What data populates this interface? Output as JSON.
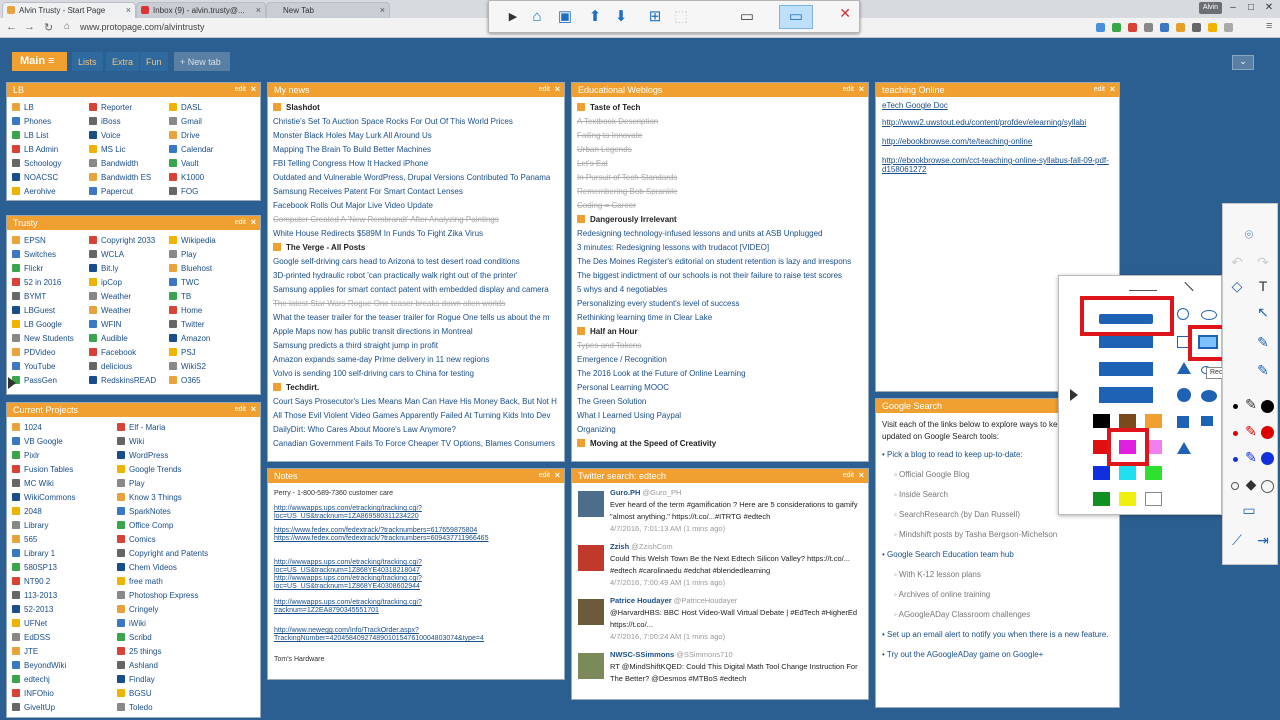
{
  "browser": {
    "tabs": [
      "Alvin Trusty - Start Page",
      "Inbox (9) - alvin.trusty@...",
      "New Tab"
    ],
    "url": "www.protopage.com/alvintrusty",
    "user": "Alvin"
  },
  "page_tabs": {
    "main": "Main",
    "lists": "Lists",
    "extra": "Extra",
    "fun": "Fun",
    "new_tab": "+ New tab"
  },
  "edit_label": "edit",
  "lb": {
    "title": "LB",
    "col1": [
      "LB",
      "Phones",
      "LB List",
      "LB Admin",
      "Schoology",
      "NOACSC",
      "Aerohive"
    ],
    "col2": [
      "Reporter",
      "iBoss",
      "Voice",
      "MS Lic",
      "Bandwidth",
      "Bandwidth ES",
      "Papercut"
    ],
    "col3": [
      "DASL",
      "Gmail",
      "Drive",
      "Calendar",
      "Vault",
      "K1000",
      "FOG"
    ]
  },
  "trusty": {
    "title": "Trusty",
    "col1": [
      "EPSN",
      "Switches",
      "Flickr",
      "52 in 2016",
      "BYMT",
      "LBGuest",
      "LB Google",
      "New Students",
      "PDVideo",
      "YouTube",
      "PassGen"
    ],
    "col2": [
      "Copyright 2033",
      "WCLA",
      "Bit.ly",
      "ipCop",
      "Weather",
      "Weather",
      "WFIN",
      "Audible",
      "Facebook",
      "delicious",
      "RedskinsREAD"
    ],
    "col3": [
      "Wikipedia",
      "Play",
      "Bluehost",
      "TWC",
      "TB",
      "Home",
      "Twitter",
      "Amazon",
      "PSJ",
      "WikiS2",
      "O365"
    ]
  },
  "projects": {
    "title": "Current Projects",
    "col1": [
      "1024",
      "VB Google",
      "Pixlr",
      "Fusion Tables",
      "MC Wiki",
      "WikiCommons",
      "2048",
      "Library",
      "565",
      "Library 1",
      "580SP13",
      "NT90 2",
      "113-2013",
      "52-2013",
      "UFNet",
      "EdDSS",
      "JTE",
      "BeyondWiki",
      "edtechj",
      "INFOhio",
      "GiveItUp"
    ],
    "col2": [
      "Elf - Maria",
      "Wiki",
      "WordPress",
      "Google Trends",
      "Play",
      "Know 3 Things",
      "SparkNotes",
      "Office Comp",
      "Comics",
      "Copyright and Patents",
      "Chem Videos",
      "free math",
      "Photoshop Express",
      "Cringely",
      "iWiki",
      "Scribd",
      "25 things",
      "Ashland",
      "Findlay",
      "BGSU",
      "Toledo"
    ]
  },
  "news": {
    "title": "My news",
    "items": [
      {
        "t": "Slashdot",
        "k": "src"
      },
      {
        "t": "Christie's Set To Auction Space Rocks For Out Of This World Prices",
        "k": ""
      },
      {
        "t": "Monster Black Holes May Lurk All Around Us",
        "k": ""
      },
      {
        "t": "Mapping The Brain To Build Better Machines",
        "k": ""
      },
      {
        "t": "FBI Telling Congress How It Hacked iPhone",
        "k": ""
      },
      {
        "t": "Outdated and Vulnerable WordPress, Drupal Versions Contributed To Panama",
        "k": ""
      },
      {
        "t": "Samsung Receives Patent For Smart Contact Lenses",
        "k": ""
      },
      {
        "t": "Facebook Rolls Out Major Live Video Update",
        "k": ""
      },
      {
        "t": "Computer Created A 'New Rembrandt' After Analyzing Paintings",
        "k": "read"
      },
      {
        "t": "White House Redirects $589M In Funds To Fight Zika Virus",
        "k": ""
      },
      {
        "t": "The Verge - All Posts",
        "k": "src"
      },
      {
        "t": "Google self-driving cars head to Arizona to test desert road conditions",
        "k": ""
      },
      {
        "t": "3D-printed hydraulic robot 'can practically walk right out of the printer'",
        "k": ""
      },
      {
        "t": "Samsung applies for smart contact patent with embedded display and camera",
        "k": ""
      },
      {
        "t": "The latest Star Wars Rogue One teaser breaks down alien worlds",
        "k": "read"
      },
      {
        "t": "What the teaser trailer for the teaser trailer for Rogue One tells us about the m",
        "k": ""
      },
      {
        "t": "Apple Maps now has public transit directions in Montreal",
        "k": ""
      },
      {
        "t": "Samsung predicts a third straight jump in profit",
        "k": ""
      },
      {
        "t": "Amazon expands same-day Prime delivery in 11 new regions",
        "k": ""
      },
      {
        "t": "Volvo is sending 100 self-driving cars to China for testing",
        "k": ""
      },
      {
        "t": "Techdirt.",
        "k": "src"
      },
      {
        "t": "Court Says Prosecutor's Lies Means Man Can Have His Money Back, But Not H",
        "k": ""
      },
      {
        "t": "All Those Evil Violent Video Games Apparently Failed At Turning Kids Into Dev",
        "k": ""
      },
      {
        "t": "DailyDirt: Who Cares About Moore's Law Anymore?",
        "k": ""
      },
      {
        "t": "Canadian Government Fails To Force Cheaper TV Options, Blames Consumers",
        "k": ""
      }
    ]
  },
  "weblogs": {
    "title": "Educational Weblogs",
    "items": [
      {
        "t": "Taste of Tech",
        "k": "src"
      },
      {
        "t": "A Textbook Description",
        "k": "read"
      },
      {
        "t": "Failing to Innovate",
        "k": "read"
      },
      {
        "t": "Urban Legends",
        "k": "read"
      },
      {
        "t": "Let's Eat",
        "k": "read"
      },
      {
        "t": "In Pursuit of Tech Standards",
        "k": "read"
      },
      {
        "t": "Remembering Bob Sprankle",
        "k": "read"
      },
      {
        "t": "Coding = Career",
        "k": "read"
      },
      {
        "t": "Dangerously Irrelevant",
        "k": "src"
      },
      {
        "t": "Redesigning technology-infused lessons and units at ASB Unplugged",
        "k": ""
      },
      {
        "t": "3 minutes: Redesigning lessons with trudacot [VIDEO]",
        "k": ""
      },
      {
        "t": "The Des Moines Register's editorial on student retention is lazy and irrespons",
        "k": ""
      },
      {
        "t": "The biggest indictment of our schools is not their failure to raise test scores",
        "k": ""
      },
      {
        "t": "5 whys and 4 negotiables",
        "k": ""
      },
      {
        "t": "Personalizing every student's level of success",
        "k": ""
      },
      {
        "t": "Rethinking learning time in Clear Lake",
        "k": ""
      },
      {
        "t": "Half an Hour",
        "k": "src"
      },
      {
        "t": "Types and Tokens",
        "k": "read"
      },
      {
        "t": "Emergence / Recognition",
        "k": ""
      },
      {
        "t": "The 2016 Look at the Future of Online Learning",
        "k": ""
      },
      {
        "t": "Personal Learning MOOC",
        "k": ""
      },
      {
        "t": "The Green Solution",
        "k": ""
      },
      {
        "t": "What I Learned Using Paypal",
        "k": ""
      },
      {
        "t": "Organizing",
        "k": ""
      },
      {
        "t": "Moving at the Speed of Creativity",
        "k": "src"
      }
    ]
  },
  "teaching": {
    "title": "teaching Online",
    "links": [
      "eTech Google Doc",
      "http://www2.uwstout.edu/content/profdev/elearning/syllabi",
      "http://ebookbrowse.com/te/teaching-online",
      "http://ebookbrowse.com/cct-teaching-online-syllabus-fall-09-pdf-d158061272"
    ]
  },
  "notes": {
    "title": "Notes",
    "line1": "Perry - 1-800-589-7360 customer care",
    "links": [
      "http://wwwapps.ups.com/etracking/tracking.cgi?loc=US_US&tracknum=1ZA869580311234220",
      "https://www.fedex.com/fedextrack/?tracknumbers=617659875804",
      "https://www.fedex.com/fedextrack/?tracknumbers=609437711966465",
      "http://wwwapps.ups.com/etracking/tracking.cgi?loc=US_US&tracknum=1Z868YE40318218047",
      "http://wwwapps.ups.com/etracking/tracking.cgi?loc=US_US&tracknum=1Z868YE40308602944",
      "http://wwwapps.ups.com/etracking/tracking.cgi?tracknum=1Z2EA8790345551701",
      "http://www.newegg.com/Info/TrackOrder.aspx?TrackingNumber=420458409274890101547610004803074&type=4"
    ],
    "last": "Tom's Hardware"
  },
  "twitter": {
    "title": "Twitter search: edtech",
    "tweets": [
      {
        "name": "Guro.PH",
        "handle": "@Guro_PH",
        "text": "Ever heard of the term #gamification ? Here are 5 considerations to gamify \"almost anything.\" https://t.co/...#ITRTG #edtech",
        "time": "4/7/2016, 7:01:13 AM (1 mins ago)"
      },
      {
        "name": "Zzish",
        "handle": "@ZzishCom",
        "text": "Could This Welsh Town Be the Next Edtech Silicon Valley? https://t.co/... #edtech #carolinaedu #edchat #blendedlearning",
        "time": "4/7/2016, 7:00:49 AM (1 mins ago)"
      },
      {
        "name": "Patrice Houdayer",
        "handle": "@PatriceHoudayer",
        "text": "@HarvardHBS: BBC Host Video-Wall Virtual Debate | #EdTech #HigherEd https://t.co/...",
        "time": "4/7/2016, 7:00:24 AM (1 mins ago)"
      },
      {
        "name": "NWSC-SSimmons",
        "handle": "@SSimmons710",
        "text": "RT @MindShiftKQED: Could This Digital Math Tool Change Instruction For The Better? @Desmos #MTBoS #edtech",
        "time": ""
      }
    ]
  },
  "google_search": {
    "title": "Google Search",
    "intro": "Visit each of the links below to explore ways to keep yourself updated on Google Search tools:",
    "items": [
      {
        "t": "Pick a blog to read to keep up-to-date:",
        "sub": false
      },
      {
        "t": "Official Google Blog",
        "sub": true
      },
      {
        "t": "Inside Search",
        "sub": true
      },
      {
        "t": "SearchResearch (by Dan Russell)",
        "sub": true
      },
      {
        "t": "Mindshift posts by Tasha Bergson-Michelson",
        "sub": true
      },
      {
        "t": "Google Search Education team hub",
        "sub": false
      },
      {
        "t": "With K-12 lesson plans",
        "sub": true
      },
      {
        "t": "Archives of online training",
        "sub": true
      },
      {
        "t": "AGoogleADay Classroom challenges",
        "sub": true
      },
      {
        "t": "Set up an email alert to notify you when there is a new feature.",
        "sub": false
      },
      {
        "t": "Try out the AGoogleADay game on Google+",
        "sub": false
      }
    ]
  },
  "tooltip": "Rectangle",
  "colors": {
    "accent": "#f0a030",
    "page_bg": "#2b5f92",
    "highlight": "#e0141b",
    "shape_blue": "#1e62b5",
    "selected_magenta": "#e020e0"
  }
}
